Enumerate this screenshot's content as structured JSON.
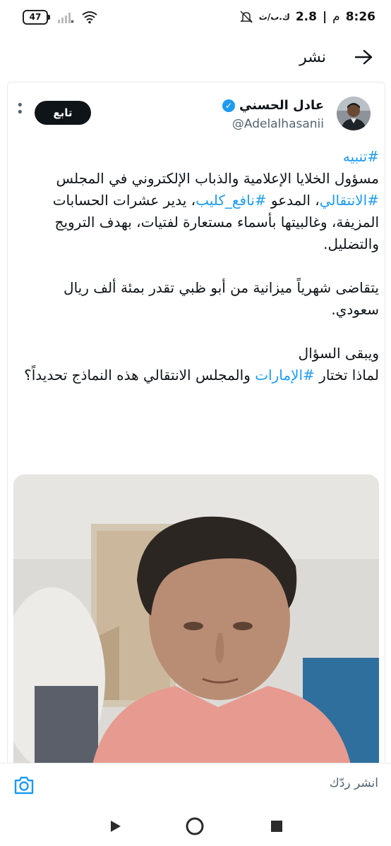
{
  "status_bar": {
    "battery": "47",
    "time": "8:26",
    "meridiem": "م",
    "speed": "2.8",
    "speed_unit": "ك.ب/ث"
  },
  "header": {
    "title": "نشر"
  },
  "tweet": {
    "author_name": "عادل الحسني",
    "handle": "@Adelalhasanii",
    "follow_label": "تابع",
    "p1_hashtag": "#تنبيه",
    "p1_line1": "مسؤول الخلايا الإعلامية والذباب الإلكتروني في المجلس",
    "p1_tag2": "#الانتقالي",
    "p1_mid": "، المدعو ",
    "p1_tag3": "#نافع_كليب",
    "p1_rest": "، يدير عشرات الحسابات المزيفة، وغالبيتها بأسماء مستعارة لفتيات، بهدف الترويج والتضليل.",
    "p2": "يتقاضى شهرياً ميزانية من أبو ظبي تقدر بمئة ألف ريال سعودي.",
    "p3_line1": "ويبقى السؤال",
    "p3_pre": "لماذا تختار ",
    "p3_tag": "#الإمارات",
    "p3_post": " والمجلس الانتقالي هذه النماذج تحديداً؟"
  },
  "reply_bar": {
    "placeholder": "انشر ردّك"
  },
  "colors": {
    "accent": "#1d9bf0",
    "text": "#0f1419",
    "muted": "#536471"
  }
}
